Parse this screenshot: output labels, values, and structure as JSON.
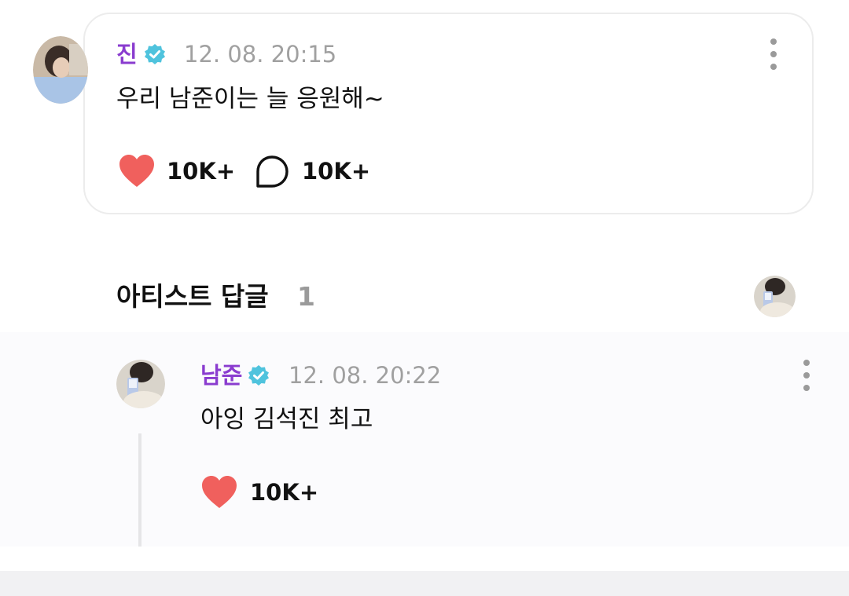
{
  "post": {
    "author": "진",
    "timestamp": "12. 08. 20:15",
    "content": "우리 남준이는 늘 응원해~",
    "like_count": "10K+",
    "comment_count": "10K+"
  },
  "replies_section": {
    "title": "아티스트 답글",
    "count": "1"
  },
  "reply": {
    "author": "남준",
    "timestamp": "12. 08. 20:22",
    "content": "아잉 김석진 최고",
    "like_count": "10K+"
  },
  "colors": {
    "author_name": "#8a3ccf",
    "verified_badge": "#4fc3dd",
    "heart": "#f0605d",
    "timestamp": "#a0a0a0"
  },
  "icons": [
    "verified-badge-icon",
    "heart-icon",
    "comment-bubble-icon",
    "more-vertical-icon"
  ]
}
